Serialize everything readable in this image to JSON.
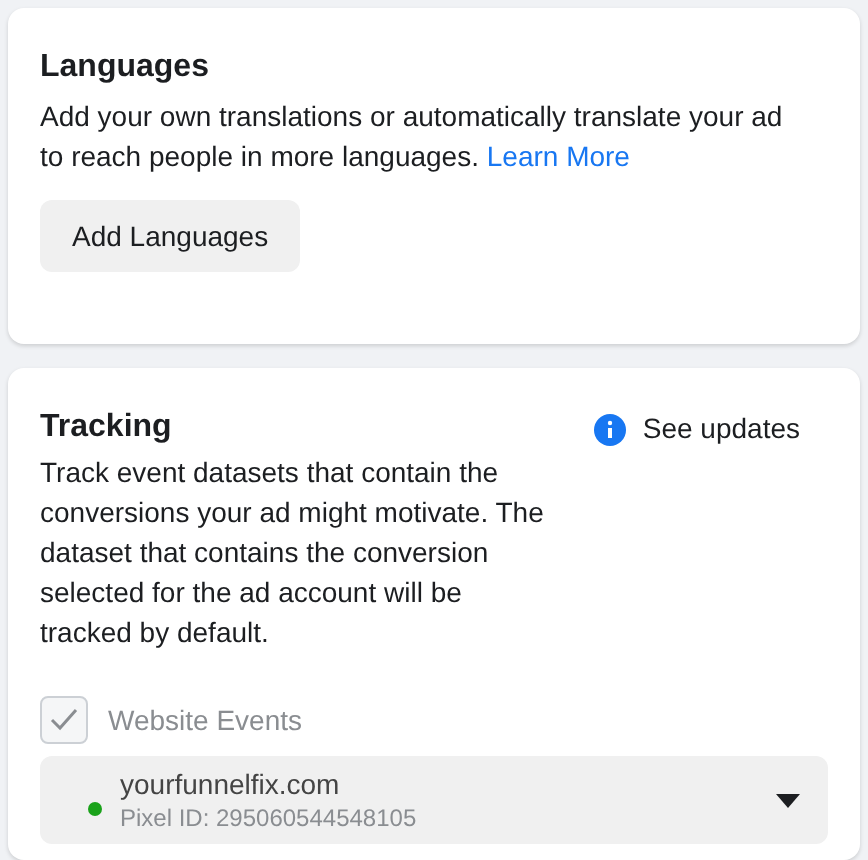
{
  "languages": {
    "title": "Languages",
    "description": "Add your own translations or automatically translate your ad to reach people in more languages.",
    "link": "Learn More",
    "button": "Add Languages"
  },
  "tracking": {
    "title": "Tracking",
    "updates_link": "See updates",
    "description": "Track event datasets that contain the conversions your ad might motivate. The dataset that contains the conversion selected for the ad account will be tracked by default.",
    "website_events": {
      "label": "Website Events",
      "checked": true,
      "disabled": true
    },
    "dataset": {
      "name": "yourfunnelfix.com",
      "pixel_id": "Pixel ID: 295060544548105",
      "color": "#1aa21a"
    }
  }
}
